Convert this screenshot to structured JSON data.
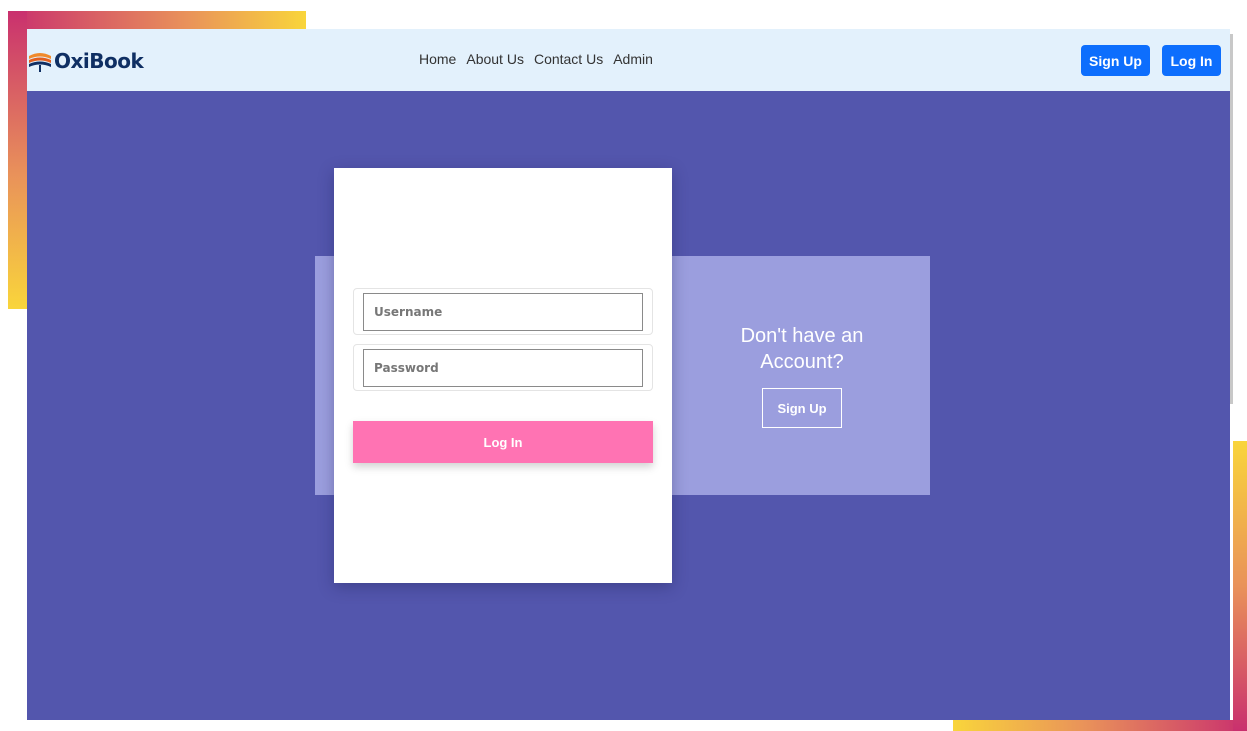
{
  "brand": {
    "name": "OxiBook",
    "logo_icon": "book-stack-icon"
  },
  "nav": {
    "links": [
      "Home",
      "About Us",
      "Contact Us",
      "Admin"
    ],
    "signup_label": "Sign Up",
    "login_label": "Log In"
  },
  "login_form": {
    "username_placeholder": "Username",
    "password_placeholder": "Password",
    "submit_label": "Log In"
  },
  "signup_prompt": {
    "title": "Don't have an Account?",
    "button_label": "Sign Up"
  },
  "colors": {
    "page_background": "#5356ad",
    "navbar_background": "#e3f1fc",
    "primary_button": "#0d6efd",
    "login_button": "#ff73b3",
    "info_panel": "#9b9ede",
    "brand_text": "#0f2f63"
  }
}
